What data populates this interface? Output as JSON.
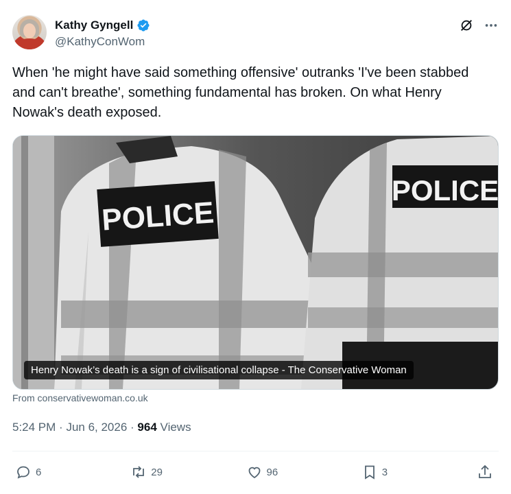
{
  "author": {
    "name": "Kathy Gyngell",
    "handle": "@KathyConWom"
  },
  "tweet": {
    "text": "When 'he might have said something offensive' outranks 'I've been stabbed and can't breathe', something fundamental has broken.  On what Henry Nowak's death exposed."
  },
  "media": {
    "vest_left": "POLICE",
    "vest_right": "POLICE",
    "caption": "Henry Nowak’s death is a sign of civilisational collapse - The Conservative Woman"
  },
  "source": "From conservativewoman.co.uk",
  "meta": {
    "time": "5:24 PM",
    "date": "Jun 6, 2026",
    "views_count": "964",
    "views_label": "Views"
  },
  "actions": {
    "replies": "6",
    "reposts": "29",
    "likes": "96",
    "bookmarks": "3"
  },
  "colors": {
    "verified": "#1d9bf0",
    "secondary_text": "#536471"
  }
}
